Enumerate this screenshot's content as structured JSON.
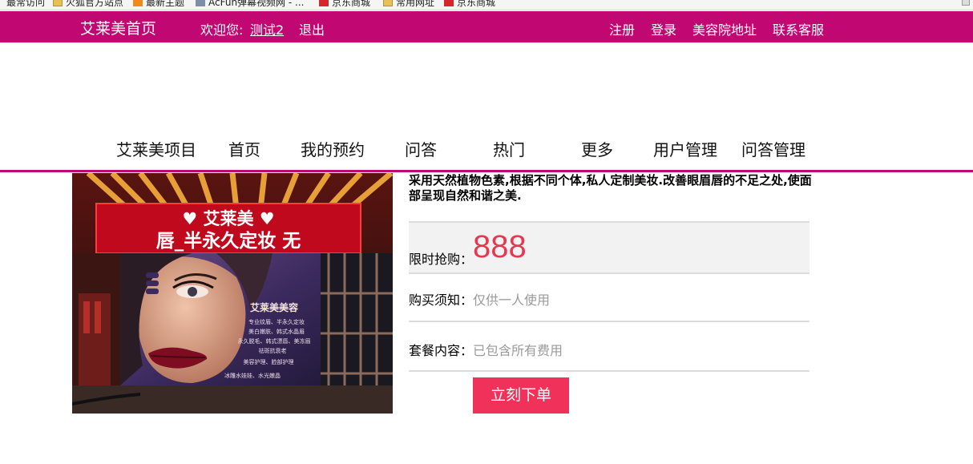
{
  "browser": {
    "bookmarks": [
      {
        "label": "最常访问",
        "icon": "none"
      },
      {
        "label": "火狐官方站点",
        "icon": "folder-icon"
      },
      {
        "label": "最新主题",
        "icon": "rss-icon"
      },
      {
        "label": "AcFun弹幕视频网 - ...",
        "icon": "acfun-icon"
      },
      {
        "label": "京东商城",
        "icon": "jd-icon"
      },
      {
        "label": "常用网址",
        "icon": "folder-icon"
      },
      {
        "label": "京东商城",
        "icon": "jd-icon"
      }
    ]
  },
  "header": {
    "brand": "艾莱美首页",
    "welcome": "欢迎您:",
    "username": "测试2",
    "logout": "退出",
    "right_links": [
      "注册",
      "登录",
      "美容院地址",
      "联系客服"
    ]
  },
  "nav": [
    "艾莱美项目",
    "首页",
    "我的预约",
    "问答",
    "热门",
    "更多",
    "用户管理",
    "问答管理"
  ],
  "product": {
    "description": "采用天然植物色素,根据不同个体,私人定制美妆.改善眼眉唇的不足之处,使面部呈现自然和谐之美.",
    "price_label": "限时抢购：",
    "price": "888",
    "notice_label": "购买须知：",
    "notice_value": "仅供一人使用",
    "package_label": "套餐内容：",
    "package_value": "已包含所有费用",
    "buy_button": "立刻下单"
  },
  "photo": {
    "sign_top": "♥ 艾莱美 ♥",
    "sign_bottom": "唇_半永久定妆 无",
    "poster_title": "艾莱美美容",
    "poster_lines": [
      "专业纹眉、半永久定妆",
      "美白嫩肤、韩式水晶眉",
      "永久脱毛、韩式漂唇、美冻眉",
      "祛斑抗衰老",
      "美容护理、脸部护理",
      "冰雕水娃娃、水光嫩晶"
    ]
  },
  "colors": {
    "brand": "#c10872",
    "price": "#e8384f",
    "button": "#f0325a"
  }
}
